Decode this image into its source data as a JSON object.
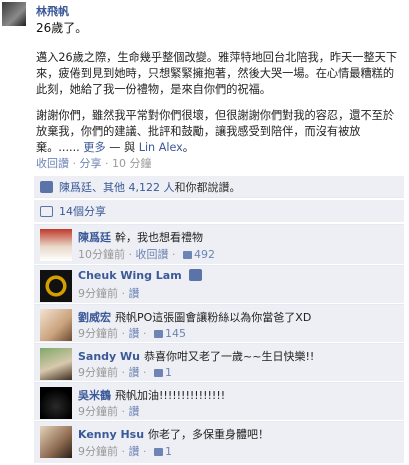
{
  "post": {
    "author": "林飛帆",
    "age_line": "26歲了。",
    "paragraph1": "邁入26歲之際，生命幾乎整個改變。雅萍特地回台北陪我，昨天一整天下來，疲倦到見到她時，只想緊緊擁抱著，然後大哭一場。在心情最糟糕的此刻，她給了我一份禮物，是來自你們的祝福。",
    "paragraph2_text": "謝謝你們，雖然我平常對你們很壞，但很謝謝你們對我的容忍，還不至於放棄我，你們的建議、批評和鼓勵，讓我感受到陪伴，而沒有被放棄。...... ",
    "more_link": "更多",
    "with_text": " — 與 ",
    "with_person": "Lin Alex",
    "with_tail": "。",
    "meta": {
      "unlike": "收回讚",
      "sep": "·",
      "share": "分享",
      "time": "10 分鐘"
    }
  },
  "likes": {
    "names": "陳爲廷、其他 ",
    "count": "4,122 人",
    "tail": "和你都說讚。"
  },
  "shares": {
    "label": "14個分享"
  },
  "comments": [
    {
      "name": "陳爲廷",
      "text": "幹，我也想看禮物",
      "time": "10分鐘前",
      "action": "收回讚",
      "likes": "492"
    },
    {
      "name": "Cheuk Wing Lam",
      "text": "",
      "time": "9分鐘前",
      "action": "讚",
      "likes": ""
    },
    {
      "name": "劉威宏",
      "text": "飛帆PO這張圖會讓粉絲以為你當爸了XD",
      "time": "9分鐘前",
      "action": "讚",
      "likes": "145"
    },
    {
      "name": "Sandy Wu",
      "text": "恭喜你咁又老了一歲~~生日快樂!!",
      "time": "9分鐘前",
      "action": "讚",
      "likes": "1"
    },
    {
      "name": "吳米鶴",
      "text": "飛帆加油!!!!!!!!!!!!!!!",
      "time": "9分鐘前",
      "action": "讚",
      "likes": ""
    },
    {
      "name": "Kenny Hsu",
      "text": "你老了，多保重身體吧！",
      "time": "9分鐘前",
      "action": "讚",
      "likes": "1"
    }
  ]
}
